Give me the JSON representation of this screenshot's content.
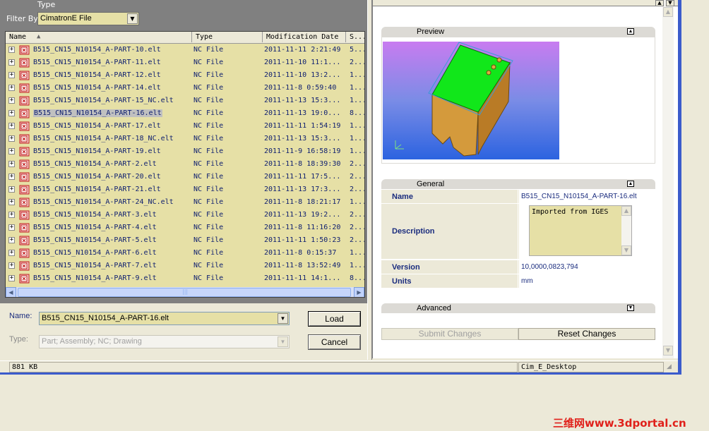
{
  "left": {
    "type_label": "Type",
    "filter_label": "Filter By:",
    "filter_value": "CimatronE File",
    "columns": {
      "name": "Name",
      "type": "Type",
      "date": "Modification Date",
      "size": "S..."
    },
    "rows": [
      {
        "name": "B515_CN15_N10154_A-PART-10.elt",
        "type": "NC File",
        "date": "2011-11-11 2:21:49",
        "size": "5..."
      },
      {
        "name": "B515_CN15_N10154_A-PART-11.elt",
        "type": "NC File",
        "date": "2011-11-10 11:1...",
        "size": "2..."
      },
      {
        "name": "B515_CN15_N10154_A-PART-12.elt",
        "type": "NC File",
        "date": "2011-11-10 13:2...",
        "size": "1..."
      },
      {
        "name": "B515_CN15_N10154_A-PART-14.elt",
        "type": "NC File",
        "date": "2011-11-8 0:59:40",
        "size": "1..."
      },
      {
        "name": "B515_CN15_N10154_A-PART-15_NC.elt",
        "type": "NC File",
        "date": "2011-11-13 15:3...",
        "size": "1..."
      },
      {
        "name": "B515_CN15_N10154_A-PART-16.elt",
        "type": "NC File",
        "date": "2011-11-13 19:0...",
        "size": "8...",
        "selected": true
      },
      {
        "name": "B515_CN15_N10154_A-PART-17.elt",
        "type": "NC File",
        "date": "2011-11-11 1:54:19",
        "size": "1..."
      },
      {
        "name": "B515_CN15_N10154_A-PART-18_NC.elt",
        "type": "NC File",
        "date": "2011-11-13 15:3...",
        "size": "1..."
      },
      {
        "name": "B515_CN15_N10154_A-PART-19.elt",
        "type": "NC File",
        "date": "2011-11-9 16:58:19",
        "size": "1..."
      },
      {
        "name": "B515_CN15_N10154_A-PART-2.elt",
        "type": "NC File",
        "date": "2011-11-8 18:39:30",
        "size": "2..."
      },
      {
        "name": "B515_CN15_N10154_A-PART-20.elt",
        "type": "NC File",
        "date": "2011-11-11 17:5...",
        "size": "2..."
      },
      {
        "name": "B515_CN15_N10154_A-PART-21.elt",
        "type": "NC File",
        "date": "2011-11-13 17:3...",
        "size": "2..."
      },
      {
        "name": "B515_CN15_N10154_A-PART-24_NC.elt",
        "type": "NC File",
        "date": "2011-11-8 18:21:17",
        "size": "1..."
      },
      {
        "name": "B515_CN15_N10154_A-PART-3.elt",
        "type": "NC File",
        "date": "2011-11-13 19:2...",
        "size": "2..."
      },
      {
        "name": "B515_CN15_N10154_A-PART-4.elt",
        "type": "NC File",
        "date": "2011-11-8 11:16:20",
        "size": "2..."
      },
      {
        "name": "B515_CN15_N10154_A-PART-5.elt",
        "type": "NC File",
        "date": "2011-11-11 1:50:23",
        "size": "2..."
      },
      {
        "name": "B515_CN15_N10154_A-PART-6.elt",
        "type": "NC File",
        "date": "2011-11-8 0:15:37",
        "size": "1..."
      },
      {
        "name": "B515_CN15_N10154_A-PART-7.elt",
        "type": "NC File",
        "date": "2011-11-8 13:52:49",
        "size": "1..."
      },
      {
        "name": "B515_CN15_N10154_A-PART-9.elt",
        "type": "NC File",
        "date": "2011-11-11 14:1...",
        "size": "8..."
      }
    ],
    "name_label": "Name:",
    "name_value": "B515_CN15_N10154_A-PART-16.elt",
    "type_field_label": "Type:",
    "type_value": "Part; Assembly; NC; Drawing",
    "load_button": "Load",
    "cancel_button": "Cancel"
  },
  "right": {
    "preview_title": "Preview",
    "general_title": "General",
    "props": {
      "name_label": "Name",
      "name_value": "B515_CN15_N10154_A-PART-16.elt",
      "desc_label": "Description",
      "desc_value": "Imported from IGES",
      "version_label": "Version",
      "version_value": "10,0000,0823,794",
      "units_label": "Units",
      "units_value": "mm"
    },
    "advanced_title": "Advanced",
    "submit_button": "Submit Changes",
    "reset_button": "Reset Changes"
  },
  "status": {
    "size": "881 KB",
    "location": "Cim_E_Desktop"
  },
  "watermark": "三维网www.3dportal.cn",
  "colors": {
    "list_bg": "#e6e0a6",
    "panel_gray": "#808080",
    "link_blue": "#1a2c7e",
    "watermark_red": "#e0201a"
  }
}
